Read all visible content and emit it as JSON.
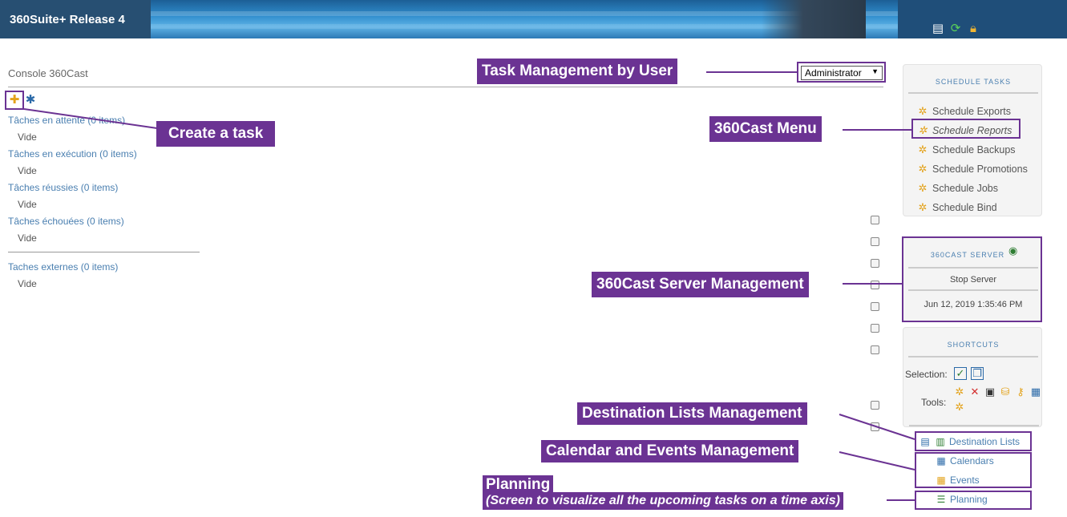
{
  "header": {
    "title": "360Suite+ Release 4",
    "icons": [
      "document-icon",
      "refresh-icon",
      "lock-icon"
    ]
  },
  "console": {
    "title": "Console 360Cast",
    "user_select": {
      "value": "Administrator"
    },
    "sections": [
      {
        "label": "Tâches en attente (0 items)",
        "empty": "Vide"
      },
      {
        "label": "Tâches en exécution (0 items)",
        "empty": "Vide"
      },
      {
        "label": "Tâches réussies (0 items)",
        "empty": "Vide"
      },
      {
        "label": "Tâches échouées (0 items)",
        "empty": "Vide"
      },
      {
        "label": "Taches externes (0 items)",
        "empty": "Vide"
      }
    ]
  },
  "schedule_tasks": {
    "title": "SCHEDULE TASKS",
    "items": [
      {
        "label": "Schedule Exports"
      },
      {
        "label": "Schedule Reports"
      },
      {
        "label": "Schedule Backups"
      },
      {
        "label": "Schedule Promotions"
      },
      {
        "label": "Schedule Jobs"
      },
      {
        "label": "Schedule Bind"
      }
    ]
  },
  "server": {
    "title": "360CAST SERVER",
    "action": "Stop Server",
    "timestamp": "Jun 12, 2019 1:35:46 PM"
  },
  "shortcuts": {
    "title": "SHORTCUTS",
    "selection_label": "Selection:",
    "tools_label": "Tools:",
    "links": {
      "destination_lists": "Destination Lists",
      "calendars": "Calendars",
      "events": "Events",
      "planning": "Planning"
    }
  },
  "annotations": {
    "task_management": "Task Management by User",
    "create_task": "Create a task",
    "menu": "360Cast Menu",
    "server_management": "360Cast Server Management",
    "destination_lists": "Destination Lists Management",
    "calendar_events": "Calendar and Events Management",
    "planning_title": "Planning",
    "planning_sub": "(Screen to visualize all the upcoming tasks on a time axis)"
  },
  "colors": {
    "accent": "#6b3393",
    "link": "#4a7fb0",
    "header": "#1f4e79"
  }
}
